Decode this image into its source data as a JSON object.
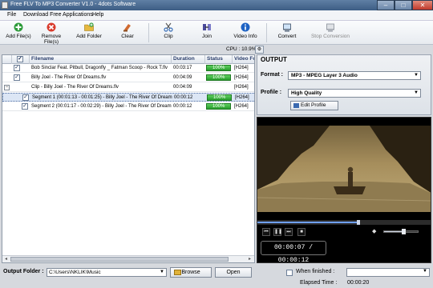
{
  "window": {
    "title": "Free FLV To MP3 Converter V1.0 - 4dots Software"
  },
  "menu": [
    "File",
    "Download Free Applications",
    "Help"
  ],
  "toolbar": {
    "buttons": [
      {
        "label": "Add File(s)",
        "icon": "add-icon",
        "color": "#2e9b3a"
      },
      {
        "label": "Remove File(s)",
        "icon": "remove-icon",
        "color": "#d93a2b"
      },
      {
        "label": "Add Folder",
        "icon": "folder-add-icon",
        "color": "#e0b23a"
      },
      {
        "label": "Clear",
        "icon": "clear-icon",
        "color": "#d06a30"
      },
      {
        "label": "Clip",
        "icon": "scissors-icon",
        "color": "#3a6fb8"
      },
      {
        "label": "Join",
        "icon": "join-icon",
        "color": "#4a4a9a"
      },
      {
        "label": "Video Info",
        "icon": "info-icon",
        "color": "#1e63c4"
      },
      {
        "label": "Convert",
        "icon": "convert-icon",
        "color": "#5a6b80"
      },
      {
        "label": "Stop Conversion",
        "icon": "stop-icon",
        "color": "#9aa0a8"
      }
    ]
  },
  "cpu": {
    "text": "CPU : 10.9%"
  },
  "grid": {
    "columns": [
      "Filename",
      "Duration",
      "Status",
      "Video Fo"
    ],
    "rows": [
      {
        "checked": true,
        "filename": "Bob Sinclar Feat. Pitbull, Dragonfly _ Fatman Scoop - Rock T.flv",
        "duration": "00:03:17",
        "status": "100%",
        "video": "[H264]"
      },
      {
        "checked": true,
        "filename": "Billy Joel - The River Of Dreams.flv",
        "duration": "00:04:09",
        "status": "100%",
        "video": "[H264]"
      },
      {
        "group": true,
        "filename": "Clip - Billy Joel - The River Of Dreams.flv",
        "duration": "00:04:09",
        "status": "",
        "video": "[H264]"
      },
      {
        "checked": true,
        "selected": true,
        "filename": "Segment 1 (00:01:13 - 00:01:25) - Billy Joel - The River Of Dreams.flv",
        "duration": "00:00:12",
        "status": "100%",
        "video": "[H264]"
      },
      {
        "checked": true,
        "filename": "Segment 2 (00:01:17 - 00:02:29) - Billy Joel - The River Of Dreams.flv",
        "duration": "00:00:12",
        "status": "100%",
        "video": "[H264]"
      }
    ]
  },
  "output": {
    "title": "OUTPUT",
    "format_label": "Format :",
    "format_value": "MP3 - MPEG Layer 3 Audio",
    "profile_label": "Profile :",
    "profile_value": "High Quality",
    "edit_profile": "Edit Profile"
  },
  "player": {
    "time": "00:00:07 / 00:00:12",
    "progress": 0.58,
    "volume": 0.55,
    "controls": [
      "previous-icon",
      "pause-icon",
      "next-icon",
      "stop-icon"
    ]
  },
  "bottom": {
    "output_folder_label": "Output Folder :",
    "output_folder_value": "C:\\Users\\NKLIK\\Music",
    "browse": "Browse",
    "open": "Open",
    "when_finished": "When finished :",
    "elapsed_label": "Elapsed Time :",
    "elapsed_value": "00:00:20"
  }
}
